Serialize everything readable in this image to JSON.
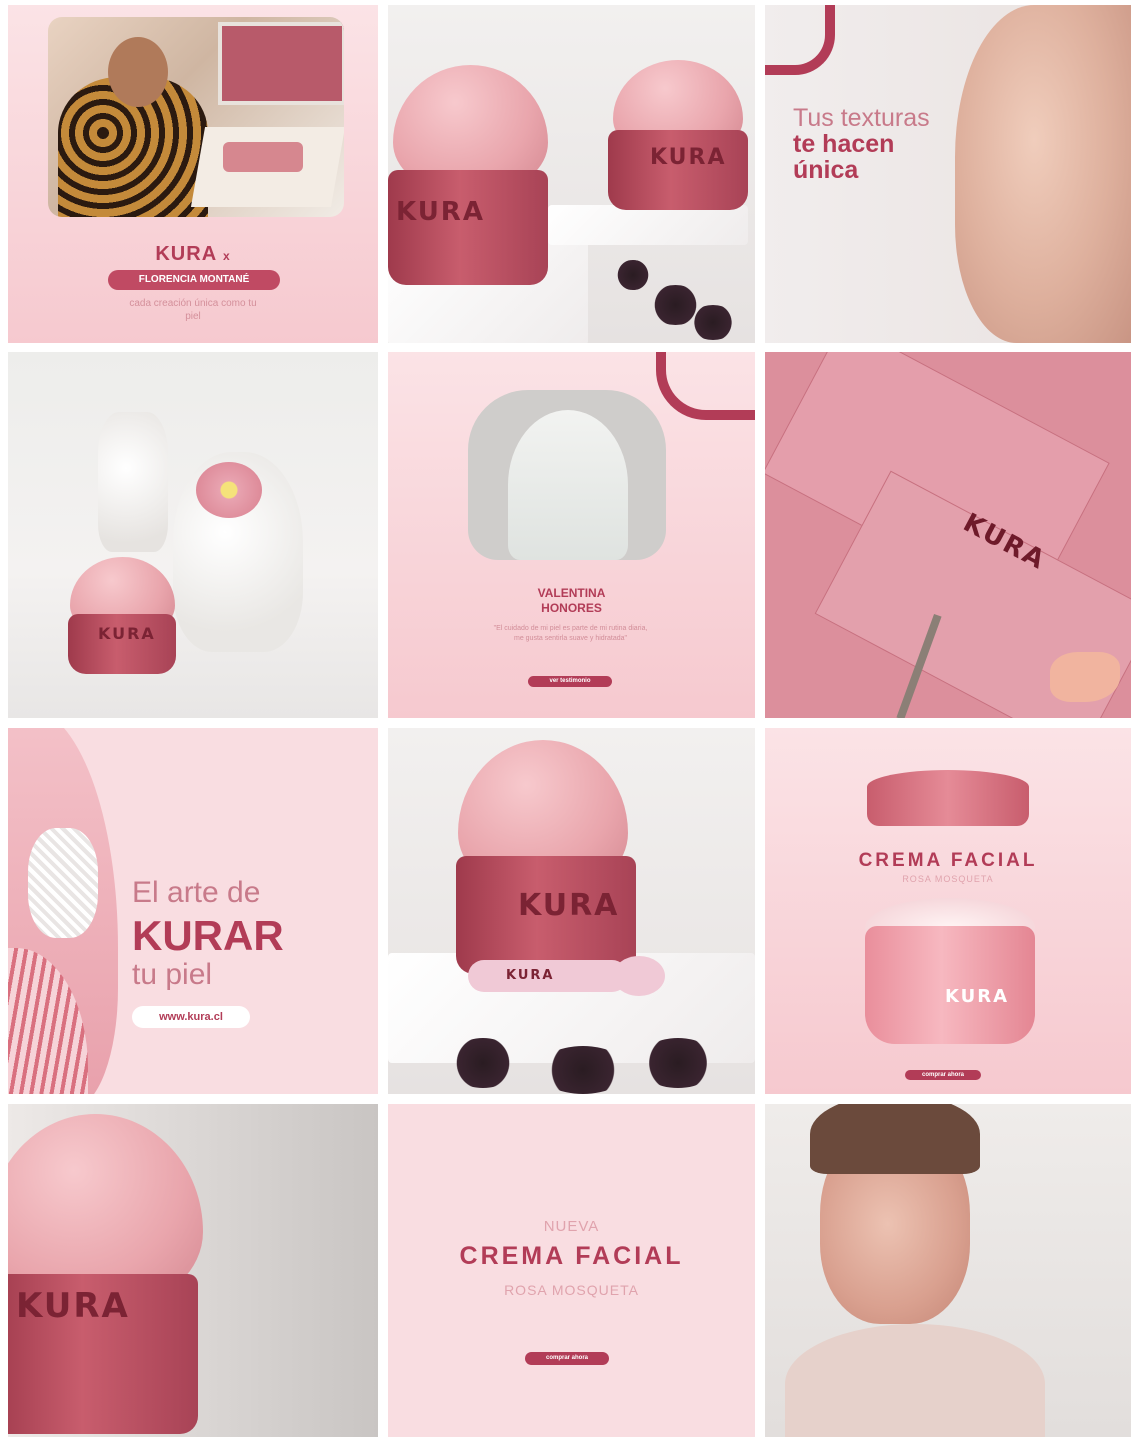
{
  "brand_color": "#b23c57",
  "accent_light": "#f9dde1",
  "tiles": {
    "t1": {
      "brand": "KURA",
      "brand_suffix": "x",
      "artist": "FLORENCIA MONTANÉ",
      "caption": "cada creación única como tu piel"
    },
    "t2": {
      "jar_label_front": "KURA",
      "jar_label_back": "KURA"
    },
    "t3": {
      "line1": "Tus texturas",
      "line2": "te hacen",
      "line3": "única"
    },
    "t4": {
      "jar_label": "KURA"
    },
    "t5": {
      "name_line1": "VALENTINA",
      "name_line2": "HONORES",
      "quote": "\"El cuidado de mi piel es parte de mi rutina diaria, me gusta sentirla suave y hidratada\"",
      "button": "ver testimonio"
    },
    "t6": {
      "box_brand": "KURA"
    },
    "t7": {
      "line1": "El arte de",
      "line2": "KURAR",
      "line3": "tu piel",
      "url": "www.kura.cl"
    },
    "t8": {
      "jar_label": "KURA",
      "spatula_label": "KURA"
    },
    "t9": {
      "title": "CREMA FACIAL",
      "subtitle": "ROSA MOSQUETA",
      "jar_label": "KURA",
      "button": "comprar ahora"
    },
    "t10": {
      "jar_label": "KURA"
    },
    "t11": {
      "line1": "NUEVA",
      "line2": "CREMA FACIAL",
      "line3": "ROSA MOSQUETA",
      "button": "comprar ahora"
    }
  }
}
